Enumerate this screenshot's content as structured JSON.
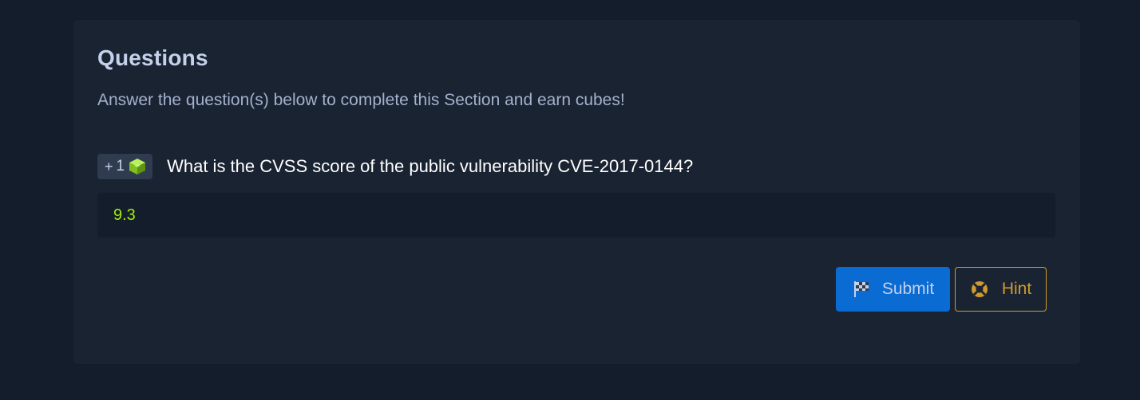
{
  "section": {
    "title": "Questions",
    "subtitle": "Answer the question(s) below to complete this Section and earn cubes!"
  },
  "question": {
    "reward_prefix": "+",
    "reward_value": "1",
    "reward_icon": "cube-icon",
    "text": "What is the CVSS score of the public vulnerability CVE-2017-0144?",
    "answer_value": "9.3"
  },
  "actions": {
    "submit_label": "Submit",
    "submit_icon": "flag-icon",
    "hint_label": "Hint",
    "hint_icon": "lifebuoy-icon"
  },
  "colors": {
    "page_background": "#141d2b",
    "card_background": "#1a2332",
    "answer_text": "#9fef00",
    "submit_button": "#0a6bd3",
    "hint_accent": "#cf9b2c"
  }
}
